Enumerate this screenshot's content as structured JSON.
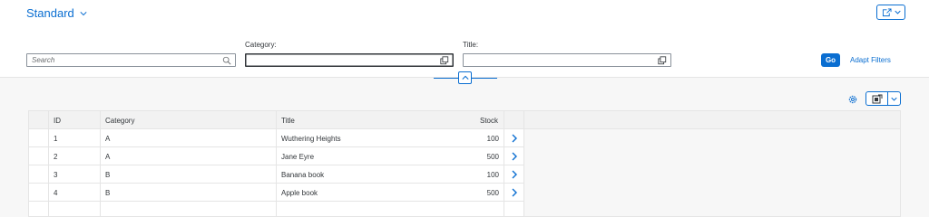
{
  "header": {
    "variant_title": "Standard"
  },
  "filters": {
    "search": {
      "placeholder": "Search",
      "value": ""
    },
    "category": {
      "label": "Category:",
      "value": ""
    },
    "title": {
      "label": "Title:",
      "value": ""
    },
    "go_label": "Go",
    "adapt_label": "Adapt Filters"
  },
  "table": {
    "columns": [
      "ID",
      "Category",
      "Title",
      "Stock"
    ],
    "rows": [
      {
        "id": "1",
        "category": "A",
        "title": "Wuthering Heights",
        "stock": "100"
      },
      {
        "id": "2",
        "category": "A",
        "title": "Jane Eyre",
        "stock": "500"
      },
      {
        "id": "3",
        "category": "B",
        "title": "Banana book",
        "stock": "100"
      },
      {
        "id": "4",
        "category": "B",
        "title": "Apple book",
        "stock": "500"
      }
    ]
  },
  "colors": {
    "accent": "#0a6ed1",
    "text": "#32363a",
    "border": "#e5e5e5",
    "background": "#f7f7f7"
  },
  "icons": {
    "variant_dropdown": "chevron-down-icon",
    "share": "share-icon",
    "search": "search-icon",
    "value_help": "value-help-icon",
    "collapse": "chevron-up-icon",
    "settings": "gear-icon",
    "export": "export-icon",
    "row_nav": "chevron-right-icon"
  }
}
